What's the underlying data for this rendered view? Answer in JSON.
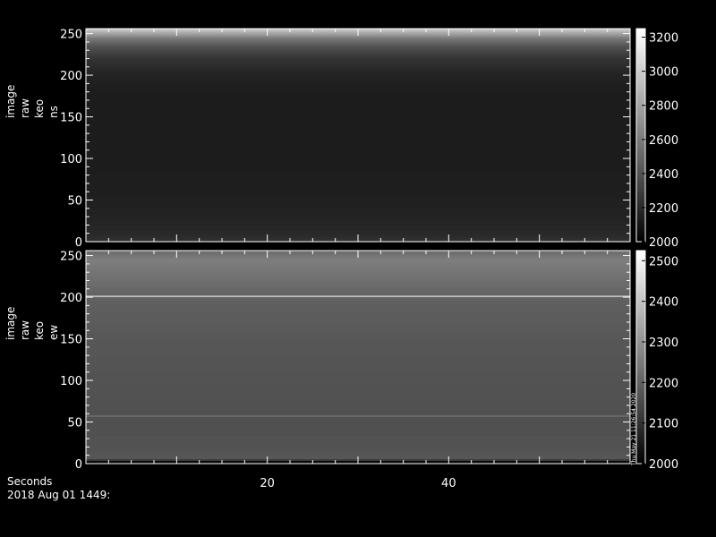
{
  "chart_data": [
    {
      "type": "heatmap",
      "ylabel_lines": [
        "image",
        "raw",
        "keo",
        "ns"
      ],
      "ylim": [
        0,
        256
      ],
      "yticks": [
        0,
        50,
        100,
        150,
        200,
        250
      ],
      "xlim": [
        0,
        60
      ],
      "xticks": [
        20,
        40
      ],
      "colorbar": {
        "range": [
          2000,
          3250
        ],
        "ticks": [
          2000,
          2200,
          2400,
          2600,
          2800,
          3000,
          3200
        ]
      },
      "intensity_profile": {
        "rows": [
          0,
          10,
          30,
          60,
          100,
          150,
          180,
          200,
          220,
          235,
          245,
          252,
          256
        ],
        "values": [
          2240,
          2200,
          2170,
          2150,
          2140,
          2135,
          2140,
          2170,
          2250,
          2400,
          2600,
          2850,
          3000
        ]
      },
      "features": []
    },
    {
      "type": "heatmap",
      "ylabel_lines": [
        "image",
        "raw",
        "keo",
        "ew"
      ],
      "ylim": [
        0,
        256
      ],
      "yticks": [
        0,
        50,
        100,
        150,
        200,
        250
      ],
      "xlim": [
        0,
        60
      ],
      "xticks": [
        20,
        40
      ],
      "colorbar": {
        "range": [
          2000,
          2525
        ],
        "ticks": [
          2000,
          2100,
          2200,
          2300,
          2400,
          2500
        ]
      },
      "intensity_profile": {
        "rows": [
          0,
          3,
          6,
          20,
          50,
          100,
          150,
          200,
          230,
          245,
          256
        ],
        "values": [
          2020,
          2020,
          2180,
          2170,
          2165,
          2170,
          2180,
          2200,
          2240,
          2260,
          2220
        ]
      },
      "features": [
        {
          "row": 201,
          "value": 2420
        },
        {
          "row": 57,
          "value": 2230
        }
      ],
      "stamp": "Thu May 21 11:26:54 2020"
    }
  ],
  "footer": {
    "xlabel": "Seconds",
    "date": "2018 Aug 01 1449:"
  }
}
